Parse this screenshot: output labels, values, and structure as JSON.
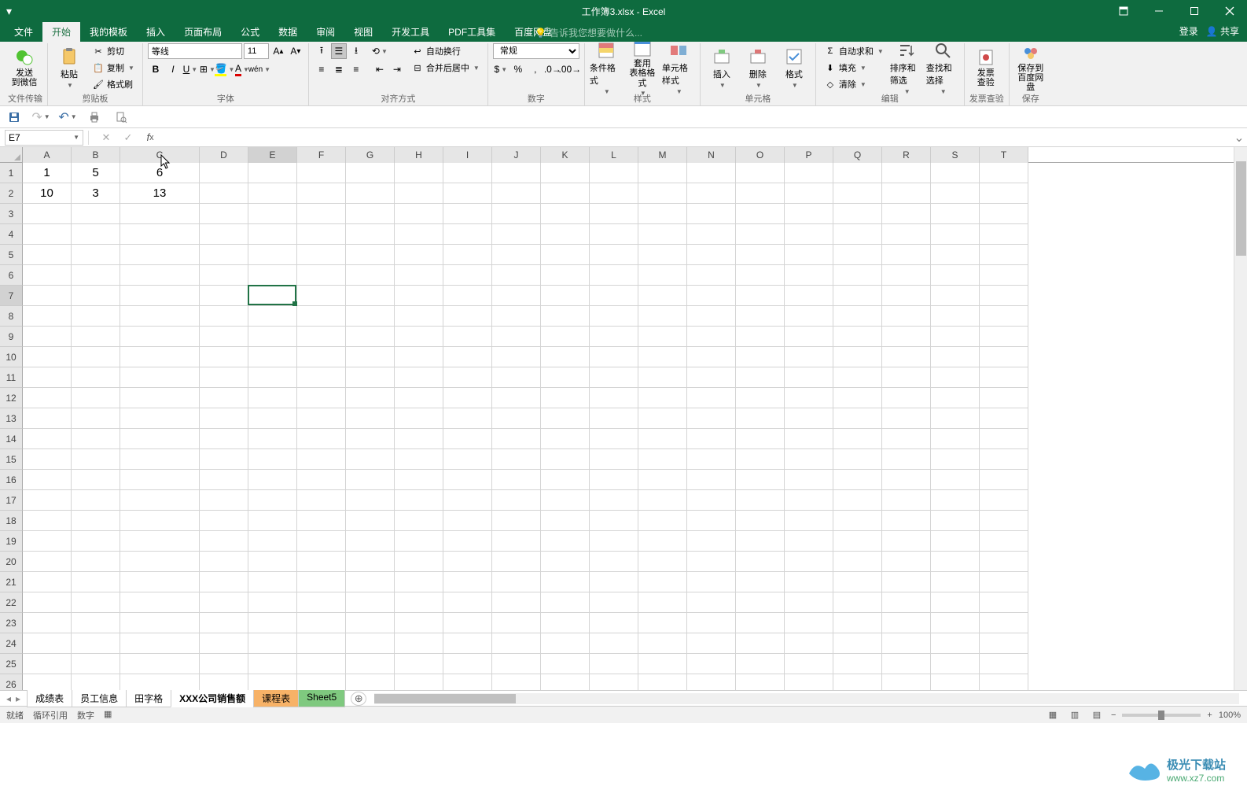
{
  "title": "工作簿3.xlsx - Excel",
  "tabs": {
    "file": "文件",
    "home": "开始",
    "templates": "我的模板",
    "insert": "插入",
    "layout": "页面布局",
    "formulas": "公式",
    "data": "数据",
    "review": "审阅",
    "view": "视图",
    "dev": "开发工具",
    "pdf": "PDF工具集",
    "baidu": "百度网盘"
  },
  "help_prompt": "告诉我您想要做什么...",
  "account": {
    "login": "登录",
    "share": "共享"
  },
  "ribbon": {
    "groups": {
      "wechat": "文件传输",
      "clipboard": "剪贴板",
      "font": "字体",
      "align": "对齐方式",
      "number": "数字",
      "styles": "样式",
      "cells": "单元格",
      "editing": "编辑",
      "invoice": "发票查验",
      "save": "保存"
    },
    "wechat_send": "发送\n到微信",
    "paste": "粘贴",
    "cut": "剪切",
    "copy": "复制",
    "format_painter": "格式刷",
    "font_name": "等线",
    "font_size": "11",
    "wrap": "自动换行",
    "merge": "合并后居中",
    "num_format": "常规",
    "cond_fmt": "条件格式",
    "table_fmt": "套用\n表格格式",
    "cell_styles": "单元格样式",
    "insert_btn": "插入",
    "delete_btn": "删除",
    "format_btn": "格式",
    "autosum": "自动求和",
    "fill": "填充",
    "clear": "清除",
    "sort": "排序和筛选",
    "find": "查找和选择",
    "invoice_btn": "发票\n查验",
    "save_baidu": "保存到\n百度网盘"
  },
  "name_box": "E7",
  "columns": [
    "A",
    "B",
    "C",
    "D",
    "E",
    "F",
    "G",
    "H",
    "I",
    "J",
    "K",
    "L",
    "M",
    "N",
    "O",
    "P",
    "Q",
    "R",
    "S",
    "T"
  ],
  "row_count": 26,
  "active": {
    "col": 4,
    "row": 6
  },
  "cell_data": {
    "0": {
      "0": "1",
      "1": "5",
      "2": "6"
    },
    "1": {
      "0": "10",
      "1": "3",
      "2": "13"
    }
  },
  "sheet_tabs": [
    {
      "name": "成绩表",
      "cls": ""
    },
    {
      "name": "员工信息",
      "cls": ""
    },
    {
      "name": "田字格",
      "cls": ""
    },
    {
      "name": "XXX公司销售额",
      "cls": "active"
    },
    {
      "name": "课程表",
      "cls": "orange"
    },
    {
      "name": "Sheet5",
      "cls": "green"
    }
  ],
  "status": {
    "ready": "就绪",
    "circ": "循环引用",
    "num": "数字",
    "zoom": "100%"
  },
  "watermark": {
    "brand": "极光下载站",
    "url": "www.xz7.com"
  }
}
